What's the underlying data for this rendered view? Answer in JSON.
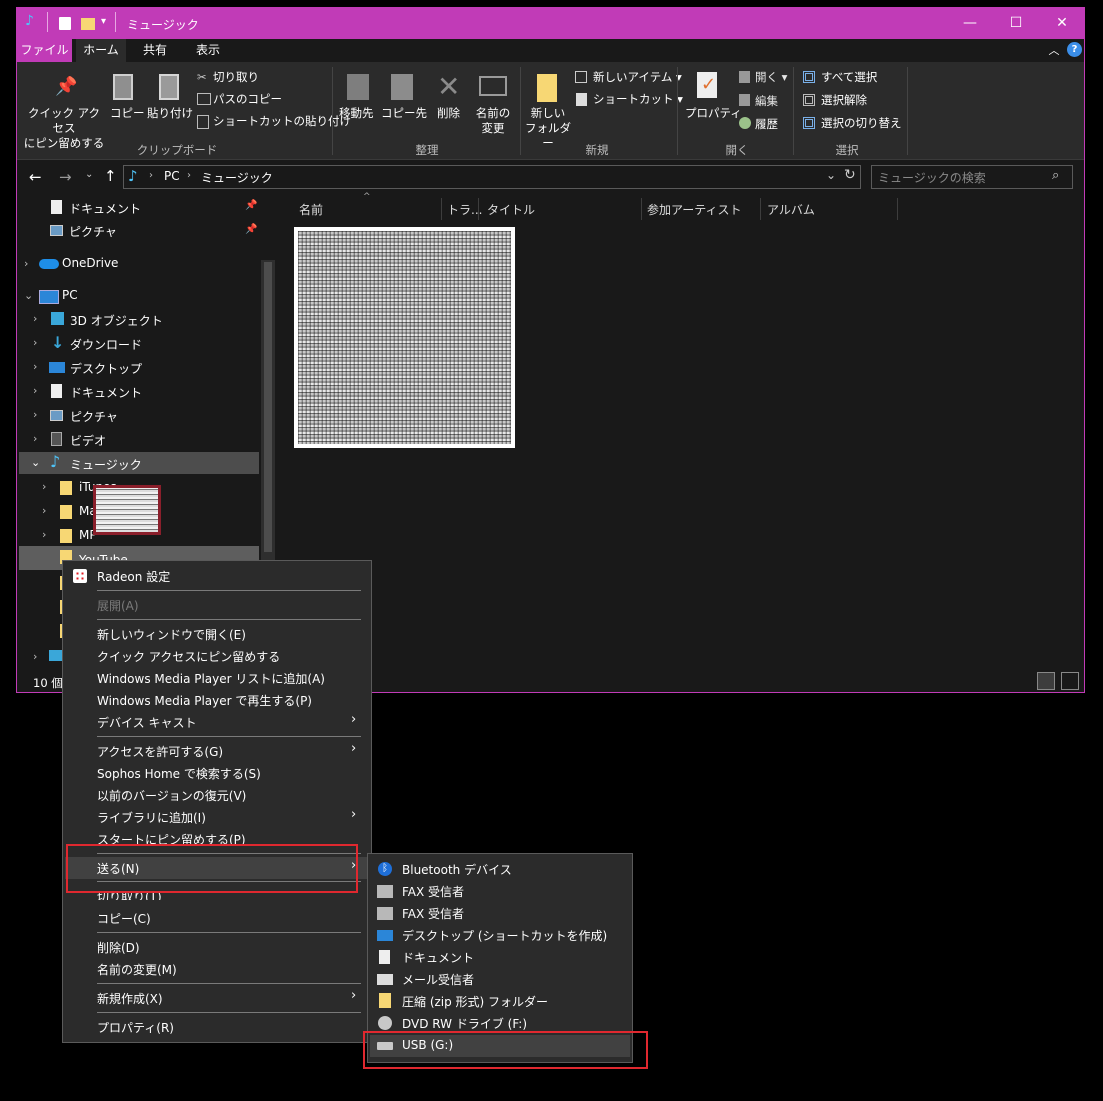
{
  "window": {
    "title": "ミュージック",
    "accent": "#c13bb7",
    "controls": {
      "minimize": "—",
      "maximize": "☐",
      "close": "✕"
    }
  },
  "ribbon_tabs": [
    "ファイル",
    "ホーム",
    "共有",
    "表示"
  ],
  "ribbon": {
    "pin": "クイック アクセス\nにピン留めする",
    "copy": "コピー",
    "paste": "貼り付け",
    "cut": "切り取り",
    "copy_path": "パスのコピー",
    "paste_shortcut": "ショートカットの貼り付け",
    "group_clipboard": "クリップボード",
    "move_to": "移動先",
    "copy_to": "コピー先",
    "delete": "削除",
    "rename": "名前の\n変更",
    "group_organize": "整理",
    "new_folder": "新しい\nフォルダー",
    "new_item": "新しいアイテム ▾",
    "shortcut": "ショートカット ▾",
    "group_new": "新規",
    "properties": "プロパティ",
    "open": "開く ▾",
    "edit": "編集",
    "history": "履歴",
    "group_open": "開く",
    "select_all": "すべて選択",
    "select_none": "選択解除",
    "invert_selection": "選択の切り替え",
    "group_select": "選択"
  },
  "address": {
    "crumb1": "PC",
    "crumb2": "ミュージック",
    "search_placeholder": "ミュージックの検索"
  },
  "columns": [
    "名前",
    "トラ...",
    "タイトル",
    "参加アーティスト",
    "アルバム"
  ],
  "nav": {
    "pinned": [
      "ドキュメント",
      "ピクチャ"
    ],
    "onedrive": "OneDrive",
    "pc": "PC",
    "pc_items": [
      "3D オブジェクト",
      "ダウンロード",
      "デスクトップ",
      "ドキュメント",
      "ピクチャ",
      "ビデオ",
      "ミュージック"
    ],
    "music_children": [
      "iTunes",
      "Ma",
      "MP",
      "YouTube"
    ]
  },
  "status": {
    "count": "10 個"
  },
  "context_menu": {
    "radeon": "Radeon 設定",
    "expand": "展開(A)",
    "open_new_window": "新しいウィンドウで開く(E)",
    "pin_quick": "クイック アクセスにピン留めする",
    "wmp_add": "Windows Media Player リストに追加(A)",
    "wmp_play": "Windows Media Player で再生する(P)",
    "cast": "デバイス キャスト",
    "give_access": "アクセスを許可する(G)",
    "sophos": "Sophos Home で検索する(S)",
    "restore": "以前のバージョンの復元(V)",
    "library": "ライブラリに追加(I)",
    "pin_start": "スタートにピン留めする(P)",
    "send_to": "送る(N)",
    "cut": "切り取り(T)",
    "copy": "コピー(C)",
    "delete": "削除(D)",
    "rename": "名前の変更(M)",
    "new": "新規作成(X)",
    "properties": "プロパティ(R)"
  },
  "send_to_menu": {
    "bluetooth": "Bluetooth デバイス",
    "fax1": "FAX 受信者",
    "fax2": "FAX 受信者",
    "desktop": "デスクトップ (ショートカットを作成)",
    "documents": "ドキュメント",
    "mail": "メール受信者",
    "zip": "圧縮 (zip 形式) フォルダー",
    "dvd": "DVD RW ドライブ (F:)",
    "usb": "USB (G:)"
  }
}
